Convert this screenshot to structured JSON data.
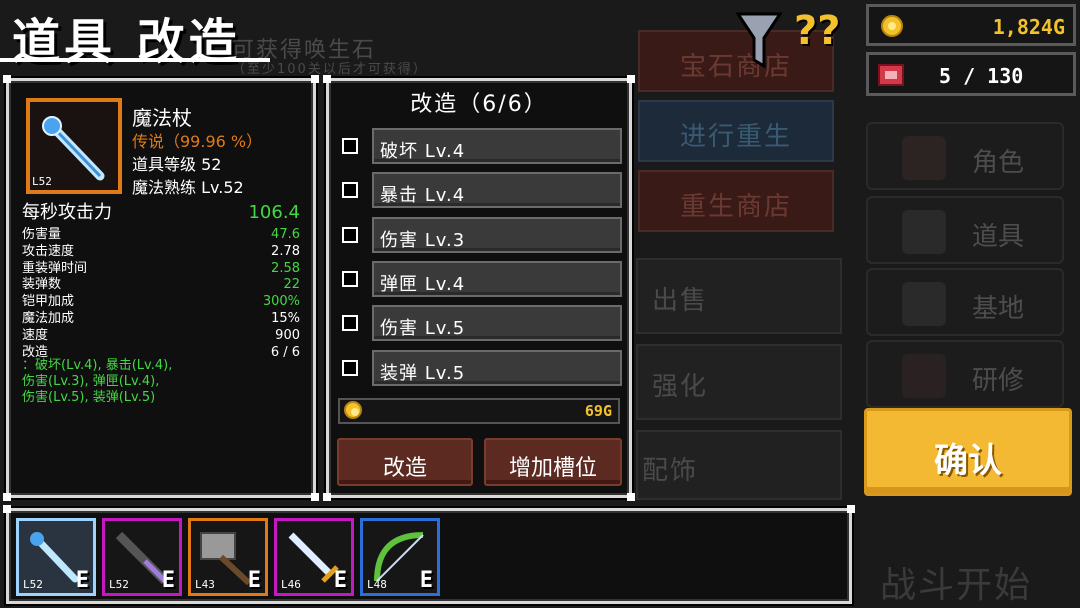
{
  "header": {
    "title": "道具 改造"
  },
  "currency": {
    "gold": "1,824G",
    "tickets": "5 / 130"
  },
  "background": {
    "notice_main": "可获得唤生石",
    "notice_sub": "（至少100关以后才可获得）",
    "buttons": [
      "宝石商店",
      "进行重生",
      "重生商店"
    ],
    "menu": [
      "出售",
      "强化",
      "配饰"
    ],
    "side_menu": [
      "角色",
      "道具",
      "基地",
      "研修"
    ],
    "battle": "战斗开始"
  },
  "confirm_label": "确认",
  "item": {
    "name": "魔法杖",
    "rarity": "传说（99.96 %）",
    "item_level_label": "道具等级",
    "item_level": "52",
    "mastery_label": "魔法熟练",
    "mastery": "Lv.52",
    "slot_level": "L52",
    "dps_label": "每秒攻击力",
    "dps": "106.4",
    "stats": [
      {
        "k": "伤害量",
        "v": "47.6",
        "color": "#43d843"
      },
      {
        "k": "攻击速度",
        "v": "2.78",
        "color": "#ffffff"
      },
      {
        "k": "重装弹时间",
        "v": "2.58",
        "color": "#43d843"
      },
      {
        "k": "装弹数",
        "v": "22",
        "color": "#43d843"
      },
      {
        "k": "铠甲加成",
        "v": "300%",
        "color": "#43d843"
      },
      {
        "k": "魔法加成",
        "v": "15%",
        "color": "#ffffff"
      },
      {
        "k": "速度",
        "v": "900",
        "color": "#ffffff"
      },
      {
        "k": "改造",
        "v": "6 / 6",
        "color": "#ffffff"
      }
    ],
    "mods_text": [
      "：破坏(Lv.4), 暴击(Lv.4),",
      "伤害(Lv.3), 弹匣(Lv.4),",
      "伤害(Lv.5), 装弹(Lv.5)"
    ]
  },
  "modify": {
    "title": "改造（6/6）",
    "rows": [
      "破坏 Lv.4",
      "暴击 Lv.4",
      "伤害 Lv.3",
      "弹匣 Lv.4",
      "伤害 Lv.5",
      "装弹 Lv.5"
    ],
    "cost": "69G",
    "modify_button": "改造",
    "add_slot_button": "增加槽位"
  },
  "inventory": [
    {
      "level": "L52",
      "badge": "E",
      "border": "#9fd3ff"
    },
    {
      "level": "L52",
      "badge": "E",
      "border": "#c418c4"
    },
    {
      "level": "L43",
      "badge": "E",
      "border": "#e07a16"
    },
    {
      "level": "L46",
      "badge": "E",
      "border": "#c418c4"
    },
    {
      "level": "L48",
      "badge": "E",
      "border": "#2c6fd6"
    }
  ],
  "colors": {
    "accent_orange": "#e07a16",
    "stat_green": "#43d843",
    "confirm_yellow": "#f4b933"
  }
}
